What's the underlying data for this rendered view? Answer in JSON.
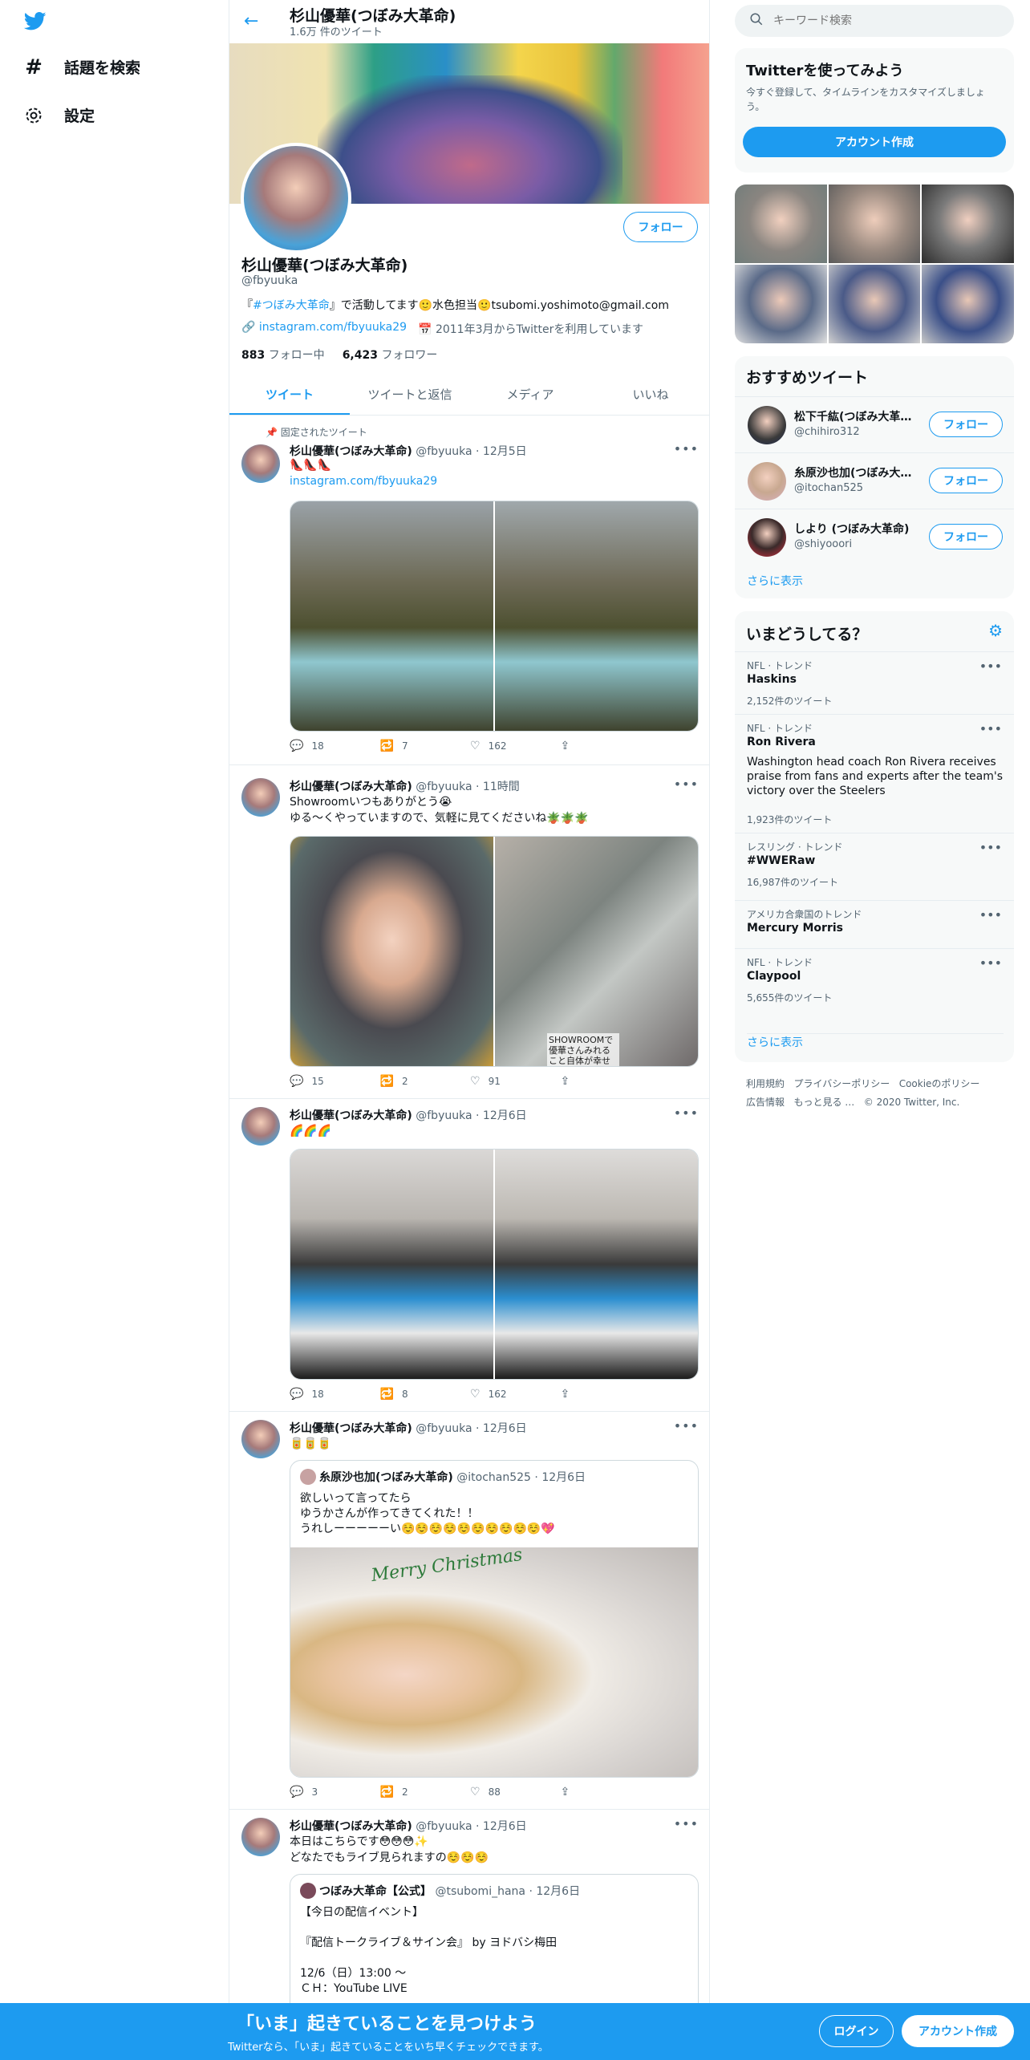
{
  "left_nav": {
    "logo_icon": "twitter-bird-icon",
    "items": [
      {
        "label": "話題を検索",
        "icon": "hashtag-icon"
      },
      {
        "label": "設定",
        "icon": "gear-icon"
      }
    ]
  },
  "header": {
    "title": "杉山優華(つぼみ大革命)",
    "subtitle": "1.6万 件のツイート"
  },
  "profile": {
    "follow_label": "フォロー",
    "name": "杉山優華(つぼみ大革命)",
    "handle": "@fbyuuka",
    "bio_prefix": "『",
    "bio_tag": "#つぼみ大革命",
    "bio_suffix": "』で活動してます🙂水色担当🙂tsubomi.yoshimoto@gmail.com",
    "link": "instagram.com/fbyuuka29",
    "joined": "2011年3月からTwitterを利用しています",
    "following_count": "883",
    "following_label": "フォロー中",
    "followers_count": "6,423",
    "followers_label": "フォロワー"
  },
  "tabs": [
    "ツイート",
    "ツイートと返信",
    "メディア",
    "いいね"
  ],
  "pinned_label": "固定されたツイート",
  "tweets": [
    {
      "name": "杉山優華(つぼみ大革命)",
      "handle": "@fbyuuka",
      "date": "12月5日",
      "text": "👠👠👠",
      "link": "instagram.com/fbyuuka29",
      "reply": "18",
      "retweet": "7",
      "like": "162"
    },
    {
      "name": "杉山優華(つぼみ大革命)",
      "handle": "@fbyuuka",
      "date": "11時間",
      "text": "Showroomいつもありがとう😭",
      "text2": "ゆる〜くやっていますので、気軽に見てくださいね🪴🪴🪴",
      "overlay": "SHOWROOMで優華さんみれること自体が幸せ",
      "reply": "15",
      "retweet": "2",
      "like": "91"
    },
    {
      "name": "杉山優華(つぼみ大革命)",
      "handle": "@fbyuuka",
      "date": "12月6日",
      "text": "🌈🌈🌈",
      "reply": "18",
      "retweet": "8",
      "like": "162"
    },
    {
      "name": "杉山優華(つぼみ大革命)",
      "handle": "@fbyuuka",
      "date": "12月6日",
      "text": "🥫🥫🥫",
      "quote": {
        "name": "糸原沙也加(つぼみ大革命)",
        "handle": "@itochan525",
        "date": "12月6日",
        "lines": [
          "欲しいって言ってたら",
          "ゆうかさんが作ってきてくれた！！",
          "うれしーーーーーい☺️☺️☺️☺️☺️☺️☺️☺️☺️☺️💖"
        ],
        "image_text": "Merry Christmas"
      },
      "reply": "3",
      "retweet": "2",
      "like": "88"
    },
    {
      "name": "杉山優華(つぼみ大革命)",
      "handle": "@fbyuuka",
      "date": "12月6日",
      "text": "本日はこちらです😳😳😳✨",
      "text2": "どなたでもライブ見られますの☺️☺️☺️",
      "quote": {
        "name": "つぼみ大革命【公式】",
        "handle": "@tsubomi_hana",
        "date": "12月6日",
        "lines": [
          "【今日の配信イベント】",
          "",
          "『配信トークライブ＆サイン会』 by ヨドバシ梅田",
          "",
          "12/6（日）13:00 ～",
          "ＣＨ：YouTube LIVE"
        ]
      }
    }
  ],
  "right": {
    "search_placeholder": "キーワード検索",
    "signup_title": "Twitterを使ってみよう",
    "signup_desc": "今すぐ登録して、タイムラインをカスタマイズしましょう。",
    "signup_button": "アカウント作成",
    "recommend_title": "おすすめツイート",
    "recommend": [
      {
        "name": "松下千紘(つぼみ大革命)",
        "handle": "@chihiro312",
        "button": "フォロー"
      },
      {
        "name": "糸原沙也加(つぼみ大革命)",
        "handle": "@itochan525",
        "button": "フォロー"
      },
      {
        "name": "しより (つぼみ大革命)",
        "handle": "@shiyooori",
        "button": "フォロー"
      }
    ],
    "show_more": "さらに表示",
    "trends_title": "いまどうしてる？",
    "trends": [
      {
        "context": "NFL · トレンド",
        "title": "Haskins",
        "desc": "",
        "count": "2,152件のツイート"
      },
      {
        "context": "NFL · トレンド",
        "title": "Ron Rivera",
        "desc": "Washington head coach Ron Rivera receives praise from fans and experts after the team's victory over the Steelers",
        "count": "1,923件のツイート"
      },
      {
        "context": "レスリング · トレンド",
        "title": "#WWERaw",
        "desc": "",
        "count": "16,987件のツイート"
      },
      {
        "context": "アメリカ合衆国のトレンド",
        "title": "Mercury Morris",
        "desc": "",
        "count": ""
      },
      {
        "context": "NFL · トレンド",
        "title": "Claypool",
        "desc": "",
        "count": "5,655件のツイート"
      }
    ],
    "trends_more": "さらに表示",
    "footer": [
      "利用規約",
      "プライバシーポリシー",
      "Cookieのポリシー",
      "広告情報",
      "もっと見る …",
      "© 2020 Twitter, Inc."
    ]
  },
  "bottom_bar": {
    "title": "「いま」起きていることを見つけよう",
    "subtitle": "Twitterなら、「いま」起きていることをいち早くチェックできます。",
    "login": "ログイン",
    "signup": "アカウント作成"
  },
  "colors": {
    "accent": "#1d9bf0",
    "text": "#0f1419",
    "muted": "#536471"
  }
}
